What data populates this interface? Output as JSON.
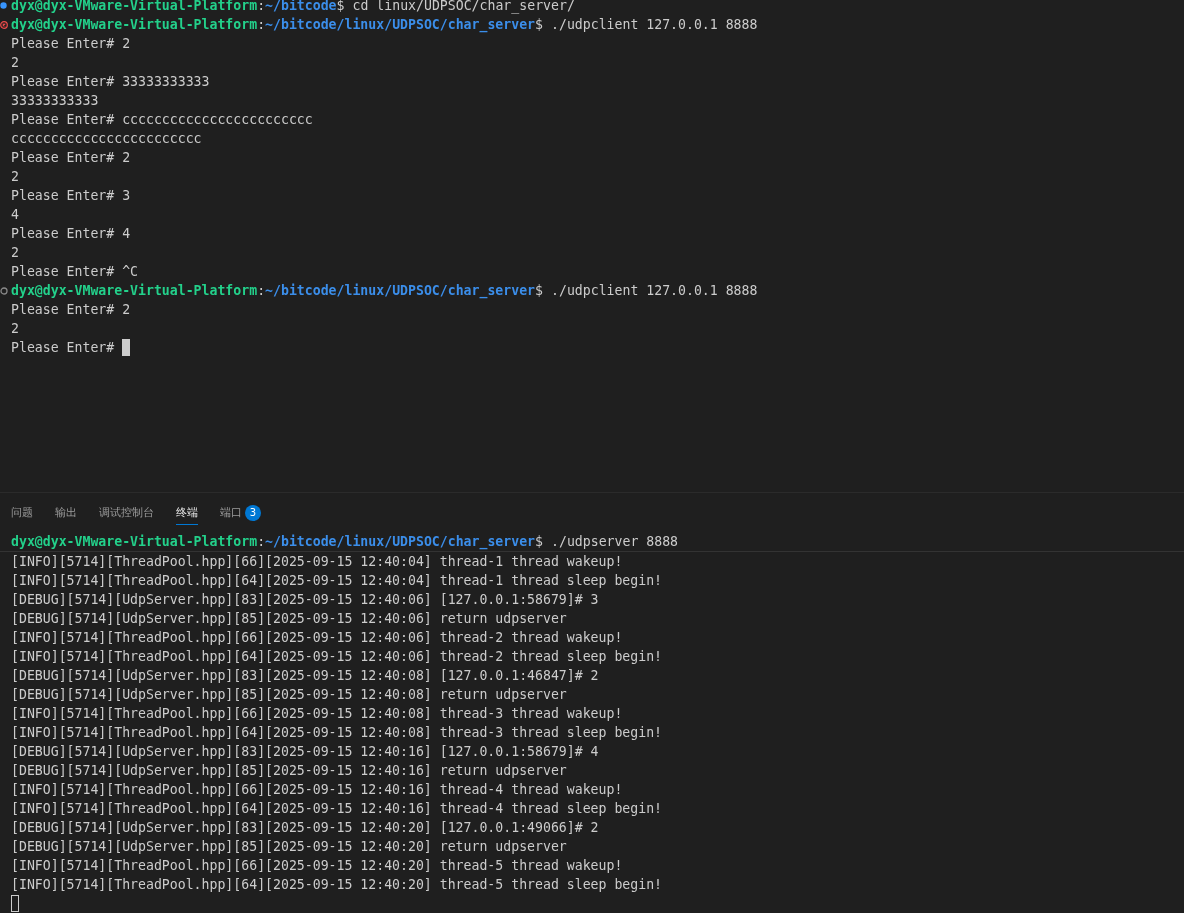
{
  "editor_terminal": {
    "lines": [
      {
        "kind": "prompt",
        "marker": {
          "kind": "dot"
        },
        "user": "dyx@dyx-VMware-Virtual-Platform",
        "separator": ":",
        "path": "~/bitcode",
        "symbol": "$",
        "command": "cd linux/UDPSOC/char_server/"
      },
      {
        "kind": "prompt",
        "marker": {
          "kind": "error"
        },
        "user": "dyx@dyx-VMware-Virtual-Platform",
        "separator": ":",
        "path": "~/bitcode/linux/UDPSOC/char_server",
        "symbol": "$",
        "command": "./udpclient 127.0.0.1 8888"
      },
      {
        "kind": "output",
        "text": "Please Enter# 2"
      },
      {
        "kind": "output",
        "text": "2"
      },
      {
        "kind": "output",
        "text": "Please Enter# 33333333333"
      },
      {
        "kind": "output",
        "text": "33333333333"
      },
      {
        "kind": "output",
        "text": "Please Enter# cccccccccccccccccccccccc"
      },
      {
        "kind": "output",
        "text": "cccccccccccccccccccccccc"
      },
      {
        "kind": "output",
        "text": "Please Enter# 2"
      },
      {
        "kind": "output",
        "text": "2"
      },
      {
        "kind": "output",
        "text": "Please Enter# 3"
      },
      {
        "kind": "output",
        "text": "4"
      },
      {
        "kind": "output",
        "text": "Please Enter# 4"
      },
      {
        "kind": "output",
        "text": "2"
      },
      {
        "kind": "output",
        "text": "Please Enter# ^C"
      },
      {
        "kind": "prompt",
        "marker": {
          "kind": "ring"
        },
        "user": "dyx@dyx-VMware-Virtual-Platform",
        "separator": ":",
        "path": "~/bitcode/linux/UDPSOC/char_server",
        "symbol": "$",
        "command": "./udpclient 127.0.0.1 8888"
      },
      {
        "kind": "output",
        "text": "Please Enter# 2"
      },
      {
        "kind": "output",
        "text": "2"
      },
      {
        "kind": "output",
        "text": "Please Enter# ",
        "cursor": {
          "kind": "block"
        }
      }
    ]
  },
  "panel": {
    "tabs": [
      {
        "label": "问题",
        "selected": false
      },
      {
        "label": "输出",
        "selected": false
      },
      {
        "label": "调试控制台",
        "selected": false
      },
      {
        "label": "终端",
        "selected": true
      },
      {
        "label": "端口",
        "selected": false,
        "badge": "3"
      }
    ],
    "sticky_prompt": {
      "user": "dyx@dyx-VMware-Virtual-Platform",
      "separator": ":",
      "path": "~/bitcode/linux/UDPSOC/char_server",
      "symbol": "$",
      "command": "./udpserver 8888"
    },
    "lines": [
      {
        "kind": "output",
        "text": "[INFO][5714][ThreadPool.hpp][66][2025-09-15 12:40:04] thread-1 thread wakeup!"
      },
      {
        "kind": "output",
        "text": "[INFO][5714][ThreadPool.hpp][64][2025-09-15 12:40:04] thread-1 thread sleep begin!"
      },
      {
        "kind": "output",
        "text": "[DEBUG][5714][UdpServer.hpp][83][2025-09-15 12:40:06] [127.0.0.1:58679]# 3"
      },
      {
        "kind": "output",
        "text": "[DEBUG][5714][UdpServer.hpp][85][2025-09-15 12:40:06] return udpserver"
      },
      {
        "kind": "output",
        "text": "[INFO][5714][ThreadPool.hpp][66][2025-09-15 12:40:06] thread-2 thread wakeup!"
      },
      {
        "kind": "output",
        "text": "[INFO][5714][ThreadPool.hpp][64][2025-09-15 12:40:06] thread-2 thread sleep begin!"
      },
      {
        "kind": "output",
        "text": "[DEBUG][5714][UdpServer.hpp][83][2025-09-15 12:40:08] [127.0.0.1:46847]# 2"
      },
      {
        "kind": "output",
        "text": "[DEBUG][5714][UdpServer.hpp][85][2025-09-15 12:40:08] return udpserver"
      },
      {
        "kind": "output",
        "text": "[INFO][5714][ThreadPool.hpp][66][2025-09-15 12:40:08] thread-3 thread wakeup!"
      },
      {
        "kind": "output",
        "text": "[INFO][5714][ThreadPool.hpp][64][2025-09-15 12:40:08] thread-3 thread sleep begin!"
      },
      {
        "kind": "output",
        "text": "[DEBUG][5714][UdpServer.hpp][83][2025-09-15 12:40:16] [127.0.0.1:58679]# 4"
      },
      {
        "kind": "output",
        "text": "[DEBUG][5714][UdpServer.hpp][85][2025-09-15 12:40:16] return udpserver"
      },
      {
        "kind": "output",
        "text": "[INFO][5714][ThreadPool.hpp][66][2025-09-15 12:40:16] thread-4 thread wakeup!"
      },
      {
        "kind": "output",
        "text": "[INFO][5714][ThreadPool.hpp][64][2025-09-15 12:40:16] thread-4 thread sleep begin!"
      },
      {
        "kind": "output",
        "text": "[DEBUG][5714][UdpServer.hpp][83][2025-09-15 12:40:20] [127.0.0.1:49066]# 2"
      },
      {
        "kind": "output",
        "text": "[DEBUG][5714][UdpServer.hpp][85][2025-09-15 12:40:20] return udpserver"
      },
      {
        "kind": "output",
        "text": "[INFO][5714][ThreadPool.hpp][66][2025-09-15 12:40:20] thread-5 thread wakeup!"
      },
      {
        "kind": "output",
        "text": "[INFO][5714][ThreadPool.hpp][64][2025-09-15 12:40:20] thread-5 thread sleep begin!"
      },
      {
        "kind": "output",
        "cursor": {
          "kind": "outline"
        }
      }
    ]
  }
}
